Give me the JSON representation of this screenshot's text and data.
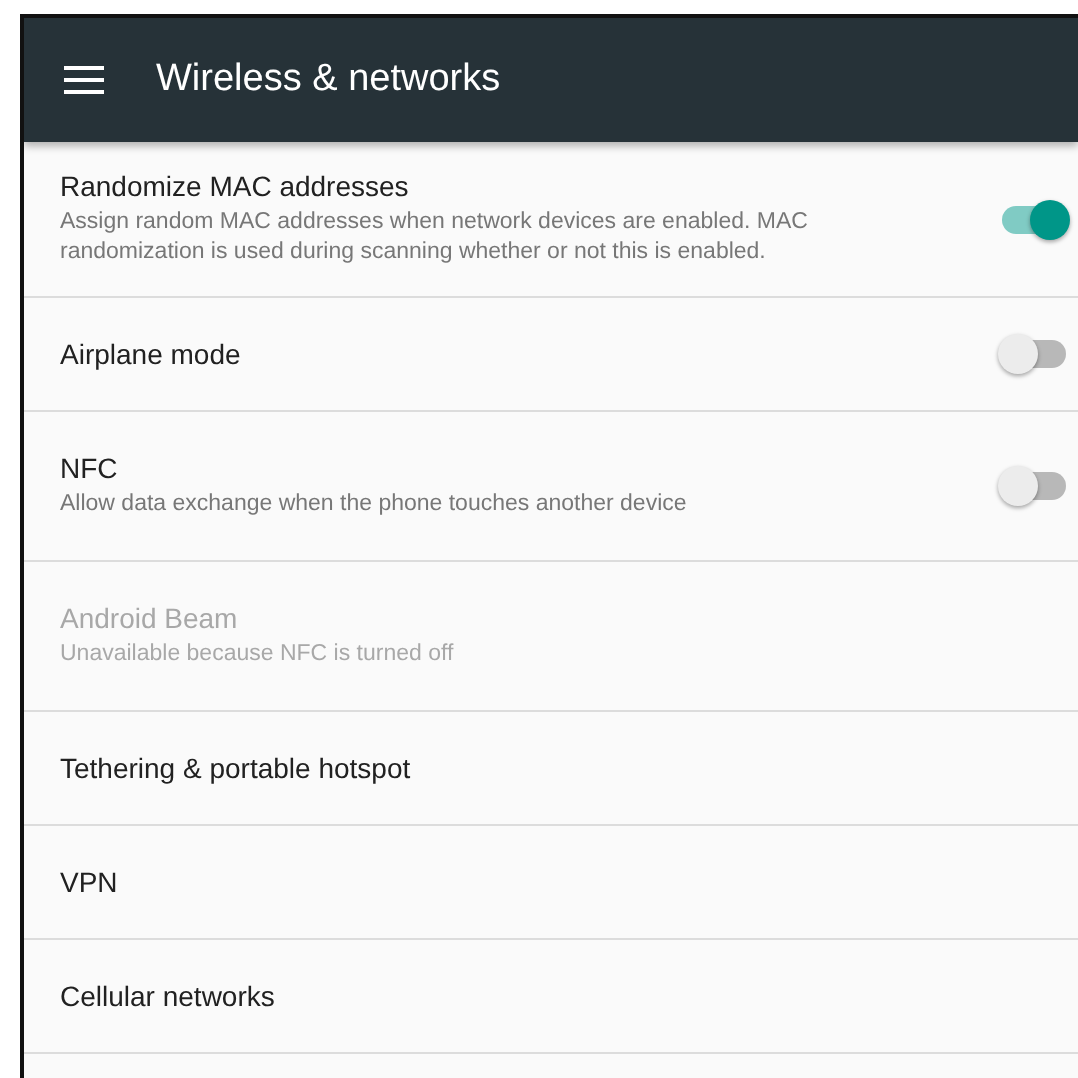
{
  "toolbar": {
    "title": "Wireless & networks"
  },
  "settings": [
    {
      "kind": "switch",
      "title": "Randomize MAC addresses",
      "summary": "Assign random MAC addresses when network devices are enabled. MAC randomization is used during scanning whether or not this is enabled.",
      "on": true,
      "disabled": false
    },
    {
      "kind": "switch",
      "title": "Airplane mode",
      "on": false,
      "disabled": false
    },
    {
      "kind": "switch",
      "title": "NFC",
      "summary": "Allow data exchange when the phone touches another device",
      "on": false,
      "disabled": false
    },
    {
      "kind": "plain",
      "title": "Android Beam",
      "summary": "Unavailable because NFC is turned off",
      "disabled": true
    },
    {
      "kind": "plain",
      "title": "Tethering & portable hotspot",
      "disabled": false
    },
    {
      "kind": "plain",
      "title": "VPN",
      "disabled": false
    },
    {
      "kind": "plain",
      "title": "Cellular networks",
      "disabled": false
    }
  ]
}
